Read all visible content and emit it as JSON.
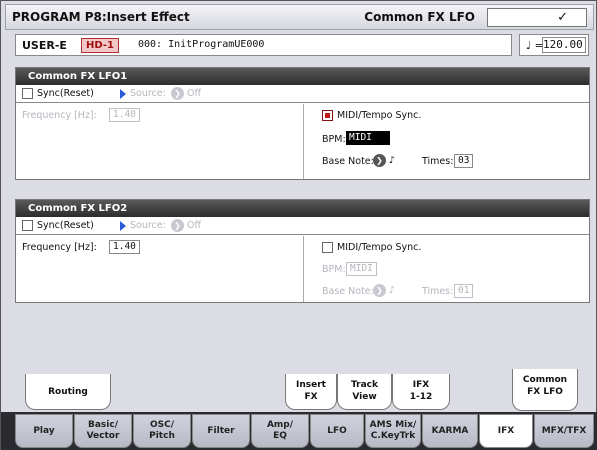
{
  "header": {
    "title": "PROGRAM P8:Insert Effect",
    "page": "Common FX LFO"
  },
  "program": {
    "bank": "USER-E",
    "hd_badge": "HD-1",
    "name": "000: InitProgramUE000",
    "tempo_symbol": "♩ =",
    "tempo": "120.00"
  },
  "lfo1": {
    "heading": "Common FX LFO1",
    "sync_label": "Sync(Reset)",
    "source_label": "Source:",
    "source_value": "Off",
    "frequency_label": "Frequency [Hz]:",
    "frequency_value": "1.40",
    "midi_sync_label": "MIDI/Tempo Sync.",
    "bpm_label": "BPM:",
    "bpm_value": "MIDI",
    "base_note_label": "Base Note:",
    "base_note_value": "♪",
    "times_label": "Times:",
    "times_value": "03"
  },
  "lfo2": {
    "heading": "Common FX LFO2",
    "sync_label": "Sync(Reset)",
    "source_label": "Source:",
    "source_value": "Off",
    "frequency_label": "Frequency [Hz]:",
    "frequency_value": "1.40",
    "midi_sync_label": "MIDI/Tempo Sync.",
    "bpm_label": "BPM:",
    "bpm_value": "MIDI",
    "base_note_label": "Base Note:",
    "base_note_value": "♪",
    "times_label": "Times:",
    "times_value": "01"
  },
  "upper_tabs": [
    {
      "line1": "Routing",
      "line2": ""
    },
    {
      "line1": "Insert",
      "line2": "FX"
    },
    {
      "line1": "Track",
      "line2": "View"
    },
    {
      "line1": "IFX",
      "line2": "1-12"
    },
    {
      "line1": "Common",
      "line2": "FX LFO"
    }
  ],
  "bottom_tabs": [
    {
      "line1": "Play",
      "line2": ""
    },
    {
      "line1": "Basic/",
      "line2": "Vector"
    },
    {
      "line1": "OSC/",
      "line2": "Pitch"
    },
    {
      "line1": "Filter",
      "line2": ""
    },
    {
      "line1": "Amp/",
      "line2": "EQ"
    },
    {
      "line1": "LFO",
      "line2": ""
    },
    {
      "line1": "AMS Mix/",
      "line2": "C.KeyTrk"
    },
    {
      "line1": "KARMA",
      "line2": ""
    },
    {
      "line1": "IFX",
      "line2": ""
    },
    {
      "line1": "MFX/TFX",
      "line2": ""
    }
  ],
  "colors": {
    "accent_red": "#c01818",
    "hd_badge_bg": "#f2c7c7",
    "source_arrow": "#2a5bd7"
  }
}
